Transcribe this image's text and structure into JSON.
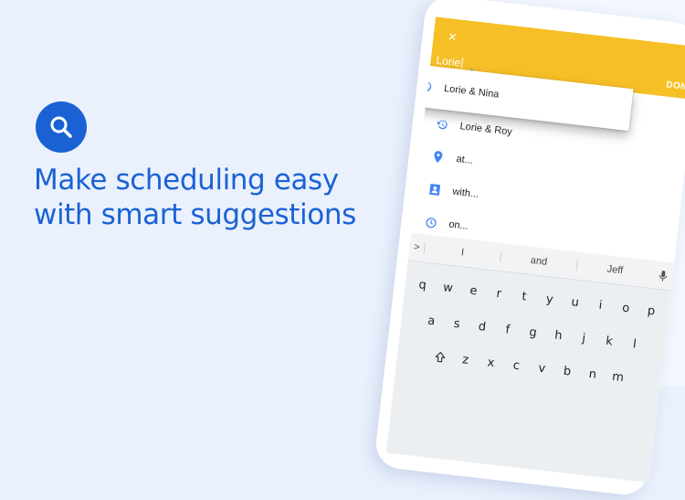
{
  "headline": {
    "line1": "Make scheduling easy",
    "line2": "with smart suggestions"
  },
  "colors": {
    "background": "#eaf1fd",
    "brand_blue": "#1a62d4",
    "appbar_yellow": "#f6bf26",
    "icon_blue": "#4285f4"
  },
  "icons": {
    "badge": "search-icon",
    "close": "close-icon"
  },
  "event_editor": {
    "close_label": "×",
    "title_value": "Lorie",
    "done_label": "DONE"
  },
  "suggestions": [
    {
      "icon": "history-icon",
      "label": "Lorie & Nina"
    },
    {
      "icon": "history-icon",
      "label": "Lorie & Roy"
    },
    {
      "icon": "location-pin-icon",
      "label": "at..."
    },
    {
      "icon": "contact-card-icon",
      "label": "with..."
    },
    {
      "icon": "clock-icon",
      "label": "on..."
    }
  ],
  "keyboard": {
    "expand_label": ">",
    "word_suggestions": [
      "I",
      "and",
      "Jeff"
    ],
    "row1": [
      "q",
      "w",
      "e",
      "r",
      "t",
      "y",
      "u",
      "i",
      "o",
      "p"
    ],
    "row2": [
      "a",
      "s",
      "d",
      "f",
      "g",
      "h",
      "j",
      "k",
      "l"
    ],
    "row3": [
      "z",
      "x",
      "c",
      "v",
      "b",
      "n",
      "m"
    ]
  }
}
